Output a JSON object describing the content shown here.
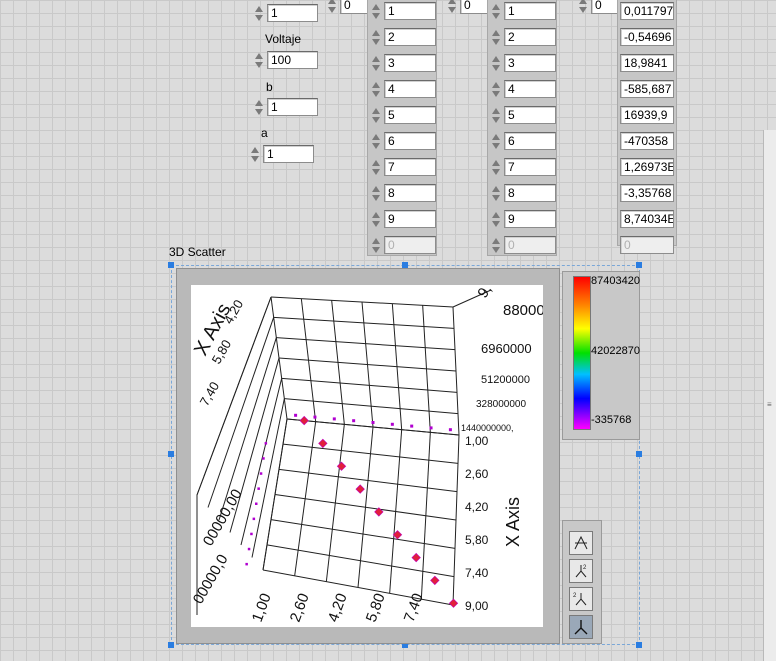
{
  "controls": {
    "top_left_value": "1",
    "voltaje": {
      "label": "Voltaje",
      "value": "100"
    },
    "b": {
      "label": "b",
      "value": "1"
    },
    "a": {
      "label": "a",
      "value": "1"
    }
  },
  "arrays": [
    {
      "index": "0",
      "values": [
        "1",
        "2",
        "3",
        "4",
        "5",
        "6",
        "7",
        "8",
        "9"
      ],
      "empty": "0"
    },
    {
      "index": "0",
      "values": [
        "1",
        "2",
        "3",
        "4",
        "5",
        "6",
        "7",
        "8",
        "9"
      ],
      "empty": "0"
    },
    {
      "index": "0",
      "values": [
        "0,011797",
        "-0,54696",
        "18,9841",
        "-585,687",
        "16939,9",
        "-470358",
        "1,26973E",
        "-3,35768",
        "8,74034E"
      ],
      "empty": "0"
    }
  ],
  "scatter": {
    "caption": "3D Scatter",
    "axis_title_left": "X Axis",
    "axis_title_right": "X Axis",
    "right_ticks": [
      "1,00",
      "2,60",
      "4,20",
      "5,80",
      "7,40",
      "9,00"
    ],
    "bottom_ticks": [
      "1,00",
      "2,60",
      "4,20",
      "5,80",
      "7,40"
    ],
    "back_ticks": [
      "88000",
      "6960000",
      "51200000",
      "328000000",
      "1440000000,"
    ],
    "left_ticks": [
      "4,20",
      "5,80",
      "7,40",
      "00000,00",
      "00000,0"
    ],
    "top_tick": "9,",
    "colorbar": {
      "max": "87403420",
      "mid": "42022870",
      "min": "-335768"
    },
    "marker_color": "#e0203c"
  },
  "chart_data": {
    "type": "scatter",
    "title": "3D Scatter",
    "xlabel": "X Axis",
    "x": [
      1,
      2,
      3,
      4,
      5,
      6,
      7,
      8,
      9
    ],
    "y": [
      1,
      2,
      3,
      4,
      5,
      6,
      7,
      8,
      9
    ],
    "z": [
      0.011797,
      -0.54696,
      18.9841,
      -585.687,
      16939.9,
      -470358,
      12697380,
      -3357680,
      87403420
    ],
    "colorbar_range": [
      -335768,
      87403420
    ]
  },
  "tools": [
    "rotate-xy-icon",
    "rotate-z-icon",
    "zoom-axis-icon",
    "pan-axes-icon"
  ]
}
